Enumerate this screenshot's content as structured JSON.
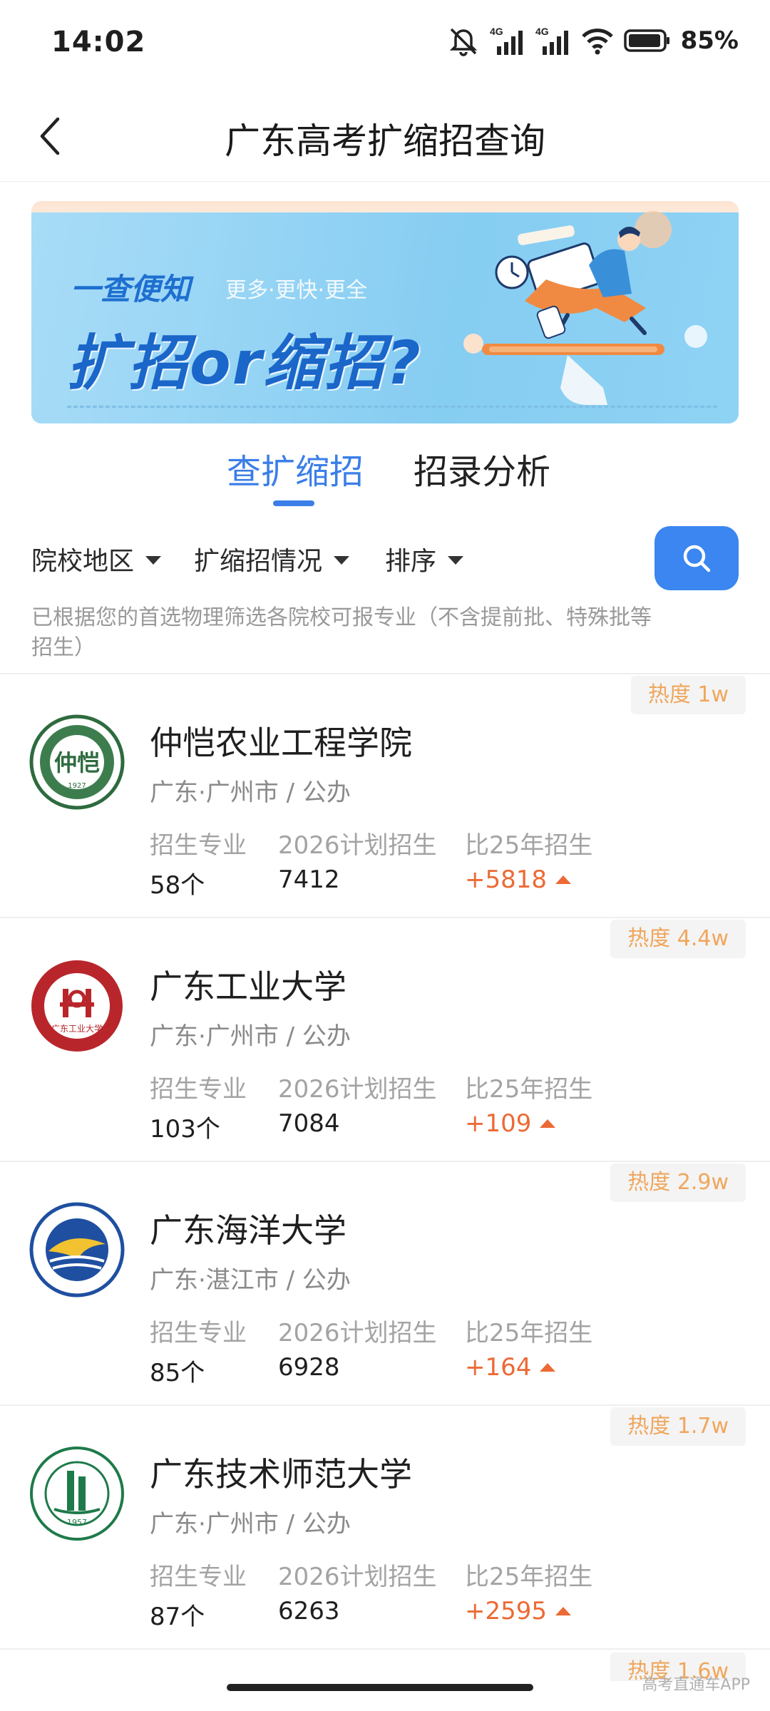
{
  "status_bar": {
    "time": "14:02",
    "battery": "85%",
    "net1": "4G",
    "net2": "4G"
  },
  "header": {
    "title": "广东高考扩缩招查询"
  },
  "banner": {
    "slogan": "一查便知",
    "subtitle": "更多·更快·更全",
    "title": "扩招or缩招?"
  },
  "tabs": [
    {
      "label": "查扩缩招",
      "active": true
    },
    {
      "label": "招录分析",
      "active": false
    }
  ],
  "filters": [
    {
      "label": "院校地区"
    },
    {
      "label": "扩缩招情况"
    },
    {
      "label": "排序"
    }
  ],
  "note": "已根据您的首选物理筛选各院校可报专业（不含提前批、特殊批等招生）",
  "stat_labels": {
    "majors": "招生专业",
    "plan": "2026计划招生",
    "change": "比25年招生"
  },
  "schools": [
    {
      "name": "仲恺农业工程学院",
      "location": "广东·广州市 / 公办",
      "heat": "热度 1w",
      "majors": "58个",
      "plan": "7412",
      "change": "+5818",
      "logo_color": "#2e6b3f"
    },
    {
      "name": "广东工业大学",
      "location": "广东·广州市 / 公办",
      "heat": "热度 4.4w",
      "majors": "103个",
      "plan": "7084",
      "change": "+109",
      "logo_color": "#b8262b"
    },
    {
      "name": "广东海洋大学",
      "location": "广东·湛江市 / 公办",
      "heat": "热度 2.9w",
      "majors": "85个",
      "plan": "6928",
      "change": "+164",
      "logo_color": "#1f4fa0"
    },
    {
      "name": "广东技术师范大学",
      "location": "广东·广州市 / 公办",
      "heat": "热度 1.7w",
      "majors": "87个",
      "plan": "6263",
      "change": "+2595",
      "logo_color": "#1e7a4a"
    }
  ],
  "peek": {
    "heat": "热度 1.6w"
  },
  "watermark": "高考直通车APP",
  "colors": {
    "accent": "#3b7ee8",
    "increase": "#ec6a35",
    "heat": "#f0a65c"
  }
}
